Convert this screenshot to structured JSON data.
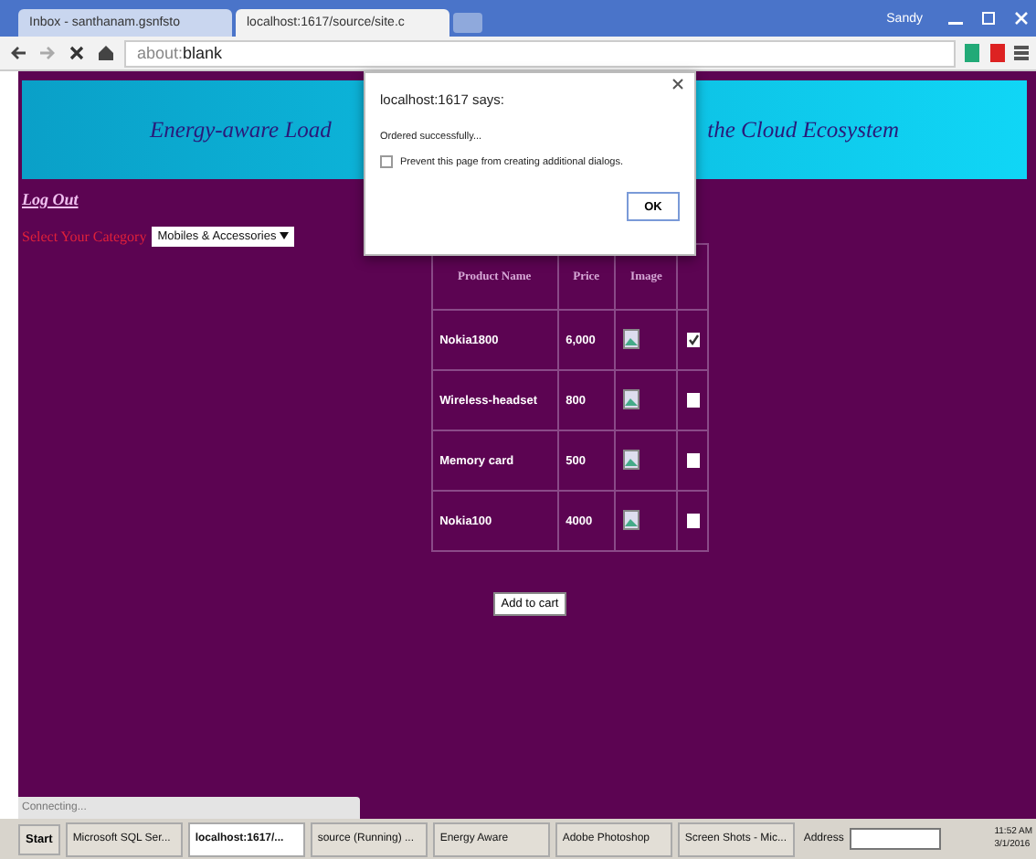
{
  "browser": {
    "tabs": [
      {
        "label": "Inbox - santhanam.gsnfsto",
        "selected": false
      },
      {
        "label": "localhost:1617/source/site.c",
        "selected": true
      }
    ],
    "user": "Sandy",
    "address": {
      "scheme": "about:",
      "value": "blank"
    }
  },
  "page": {
    "banner": {
      "left": "Energy-aware Load",
      "right": "the Cloud Ecosystem"
    },
    "logout": "Log Out",
    "category_label": "Select Your Category",
    "category": "Mobiles & Accessories",
    "table": {
      "columns": [
        "Product Name",
        "Price",
        "Image"
      ],
      "rows": [
        {
          "name": "Nokia1800",
          "price": "6,000",
          "checked": true
        },
        {
          "name": "Wireless-headset",
          "price": "800",
          "checked": false
        },
        {
          "name": "Memory card",
          "price": "500",
          "checked": false
        },
        {
          "name": "Nokia100",
          "price": "4000",
          "checked": false
        }
      ]
    },
    "add_button": "Add to cart"
  },
  "dialog": {
    "title": "localhost:1617 says:",
    "message": "Ordered successfully...",
    "prevent": {
      "label": "Prevent this page from creating additional dialogs.",
      "checked": false
    },
    "ok": "OK"
  },
  "status": "Connecting...",
  "taskbar": {
    "start": "Start",
    "items": [
      {
        "label": "Microsoft SQL Ser...",
        "selected": false
      },
      {
        "label": "localhost:1617/...",
        "selected": true
      },
      {
        "label": "source (Running) ...",
        "selected": false
      },
      {
        "label": "Energy Aware",
        "selected": false
      },
      {
        "label": "Adobe Photoshop",
        "selected": false
      },
      {
        "label": "Screen Shots - Mic...",
        "selected": false
      }
    ],
    "address_label": "Address",
    "time": "11:52 AM",
    "date": "3/1/2016"
  }
}
